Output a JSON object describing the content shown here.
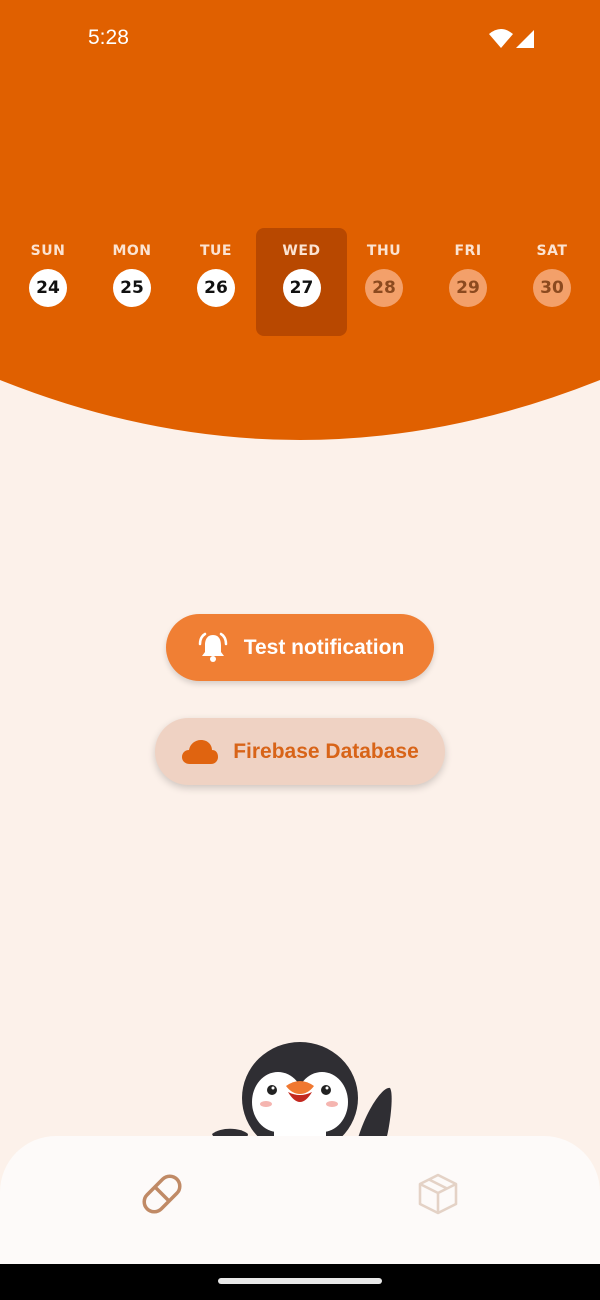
{
  "status_bar": {
    "time": "5:28"
  },
  "week": {
    "days": [
      {
        "name": "SUN",
        "date": "24",
        "state": "past"
      },
      {
        "name": "MON",
        "date": "25",
        "state": "past"
      },
      {
        "name": "TUE",
        "date": "26",
        "state": "past"
      },
      {
        "name": "WED",
        "date": "27",
        "state": "selected"
      },
      {
        "name": "THU",
        "date": "28",
        "state": "future"
      },
      {
        "name": "FRI",
        "date": "29",
        "state": "future"
      },
      {
        "name": "SAT",
        "date": "30",
        "state": "future"
      }
    ]
  },
  "buttons": {
    "test_notification": {
      "label": "Test notification",
      "icon": "bell-ring-icon"
    },
    "firebase_database": {
      "label": "Firebase Database",
      "icon": "cloud-icon"
    }
  },
  "bottom_nav": [
    {
      "icon": "pill-icon",
      "active": true
    },
    {
      "icon": "package-icon",
      "active": false
    }
  ],
  "colors": {
    "header": "#e06000",
    "selected_day": "#b84800",
    "background": "#fcf1ea",
    "primary_button": "#f07f34",
    "secondary_button": "#efd2c3"
  }
}
